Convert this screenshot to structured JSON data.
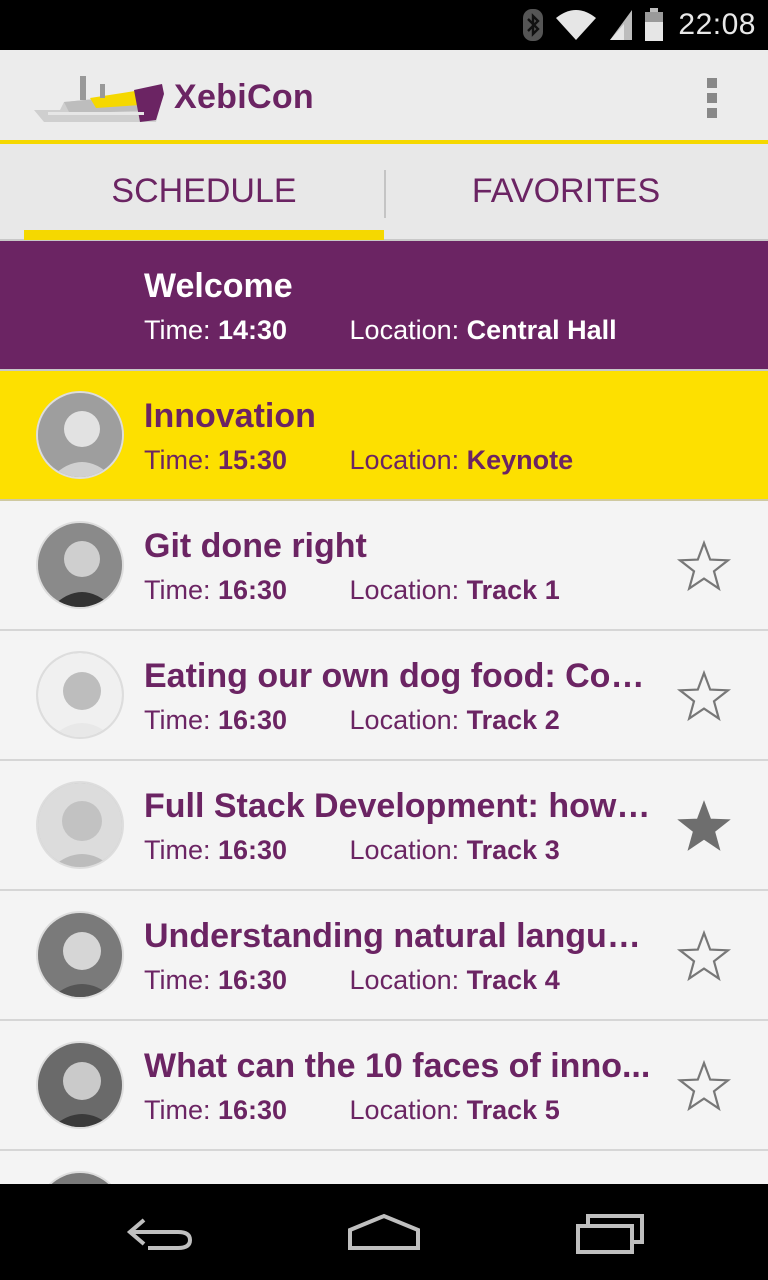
{
  "status_bar": {
    "time": "22:08",
    "icons": [
      "bluetooth-icon",
      "wifi-icon",
      "signal-icon",
      "battery-icon"
    ]
  },
  "app_bar": {
    "title": "XebiCon",
    "logo": "ship-logo",
    "menu_icon": "overflow-menu-icon"
  },
  "tabs": [
    {
      "label": "SCHEDULE",
      "selected": true
    },
    {
      "label": "FAVORITES",
      "selected": false
    }
  ],
  "labels": {
    "time": "Time:",
    "location": "Location:"
  },
  "sessions": [
    {
      "title": "Welcome",
      "time": "14:30",
      "location": "Central Hall",
      "style": "welcome",
      "avatar": false,
      "star": "none"
    },
    {
      "title": "Innovation",
      "time": "15:30",
      "location": "Keynote",
      "style": "current",
      "avatar": true,
      "star": "none"
    },
    {
      "title": "Git done right",
      "time": "16:30",
      "location": "Track 1",
      "style": "normal",
      "avatar": true,
      "star": "empty"
    },
    {
      "title": "Eating our own dog food: Con...",
      "time": "16:30",
      "location": "Track 2",
      "style": "normal",
      "avatar": true,
      "star": "empty"
    },
    {
      "title": "Full Stack Development: how t...",
      "time": "16:30",
      "location": "Track 3",
      "style": "normal",
      "avatar": true,
      "star": "filled"
    },
    {
      "title": "Understanding natural langua...",
      "time": "16:30",
      "location": "Track 4",
      "style": "normal",
      "avatar": true,
      "star": "empty"
    },
    {
      "title": "What can the 10 faces of inno...",
      "time": "16:30",
      "location": "Track 5",
      "style": "normal",
      "avatar": true,
      "star": "empty"
    }
  ],
  "colors": {
    "purple": "#6b2463",
    "yellow": "#fde000",
    "background": "#f4f4f4"
  },
  "nav_bar": [
    "back-icon",
    "home-icon",
    "recents-icon"
  ]
}
